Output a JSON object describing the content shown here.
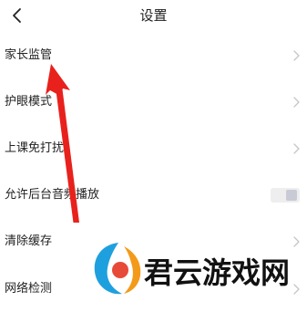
{
  "header": {
    "back_icon": "chevron-left-icon",
    "title": "设置"
  },
  "settings": [
    {
      "label": "家长监管",
      "control": "chevron"
    },
    {
      "label": "护眼模式",
      "control": "chevron"
    },
    {
      "label": "上课免打扰",
      "control": "chevron"
    },
    {
      "label": "允许后台音频播放",
      "control": "toggle",
      "toggle_on": false
    },
    {
      "label": "清除缓存",
      "control": "chevron"
    },
    {
      "label": "网络检测",
      "control": "chevron"
    }
  ],
  "annotation": {
    "shape": "arrow",
    "color": "#e8211c",
    "points_to": "家长监管"
  },
  "watermark": {
    "logo_text": "君云游戏网"
  },
  "colors": {
    "background": "#ffffff",
    "text": "#222222",
    "chevron": "#c6c6c6",
    "toggle_track": "#eeeeee",
    "toggle_knob": "#c8cad6",
    "annotation": "#e8211c"
  }
}
